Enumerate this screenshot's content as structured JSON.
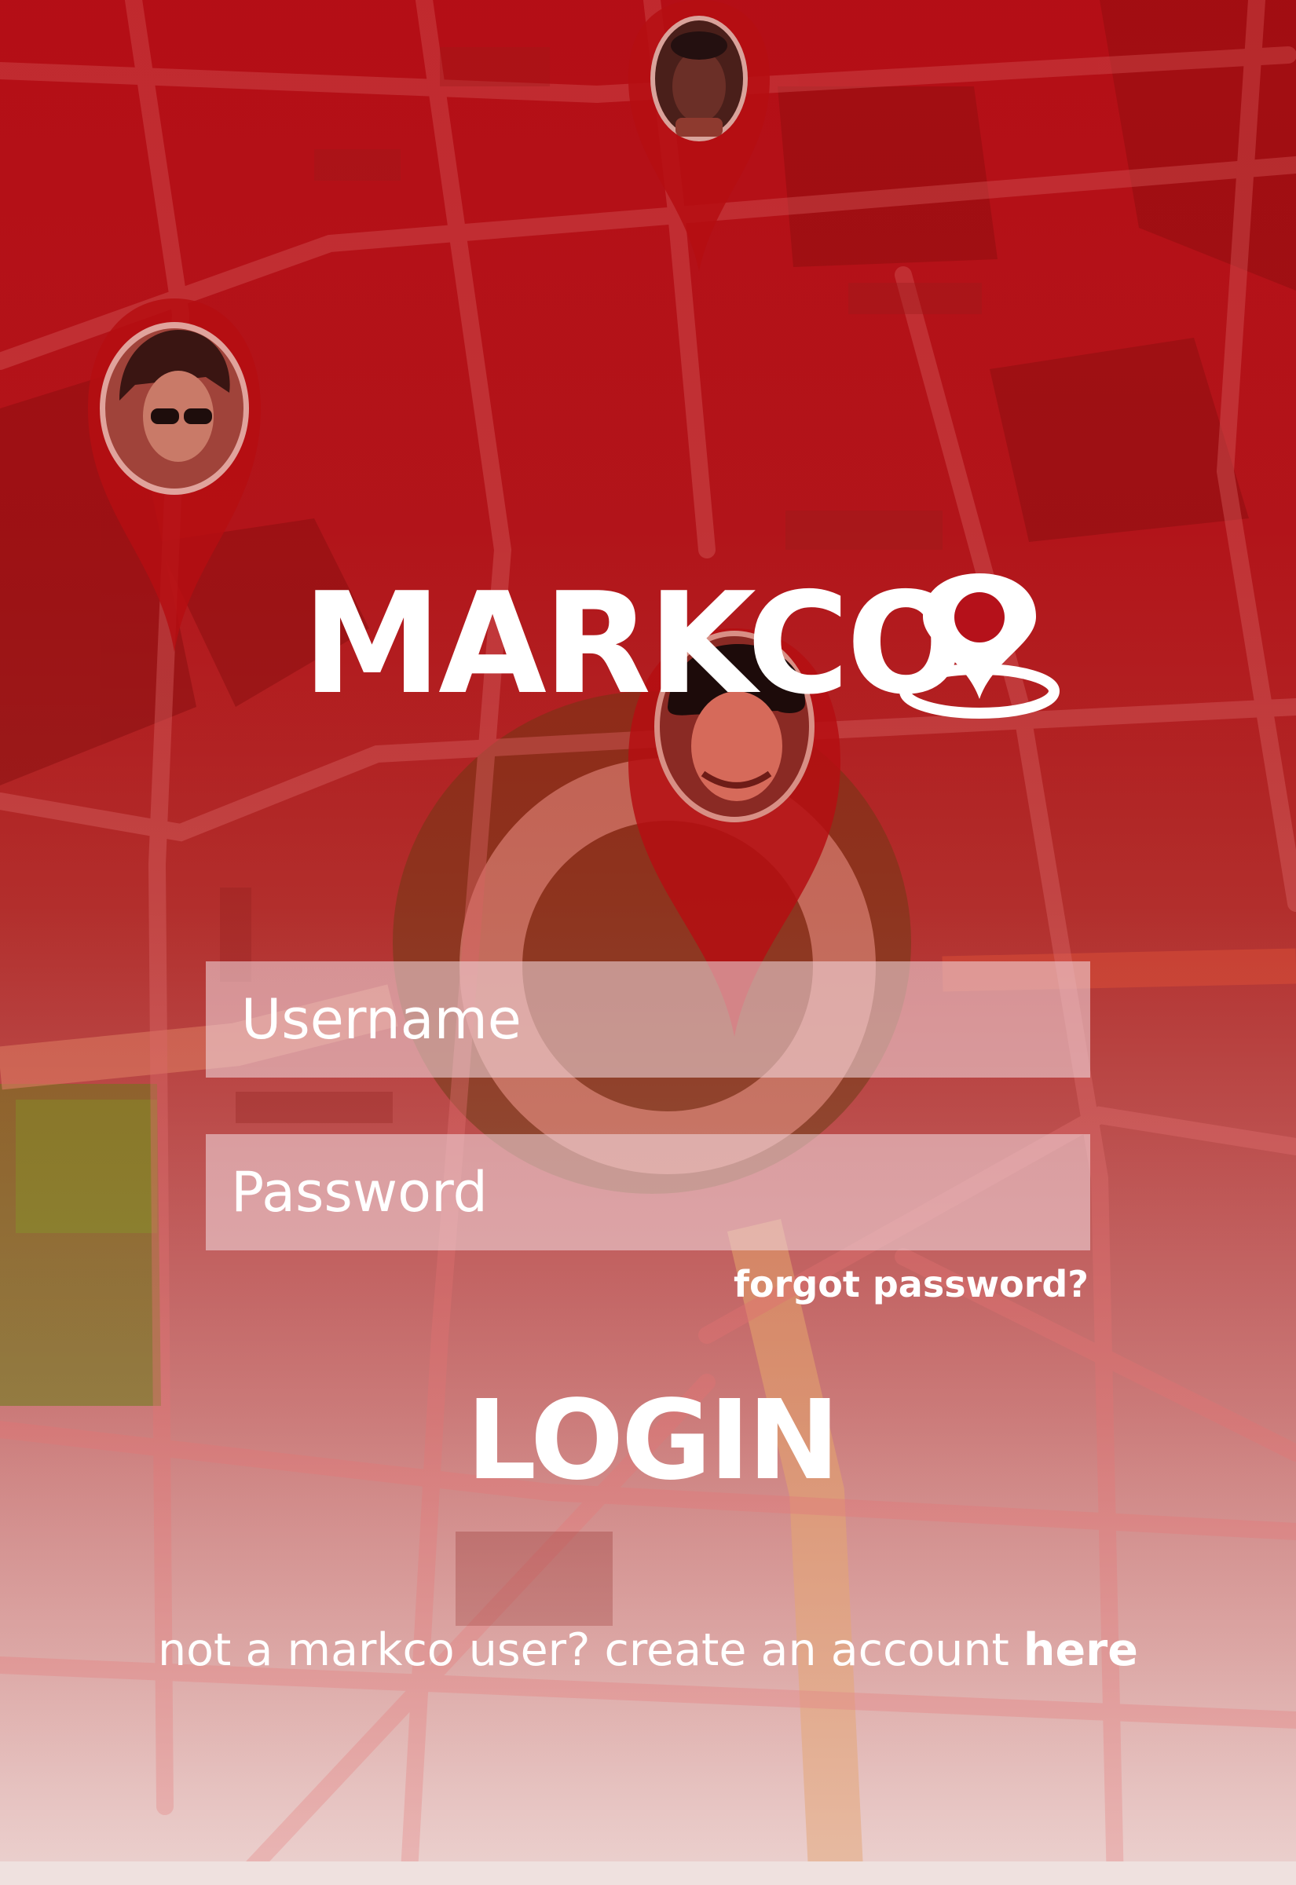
{
  "app": {
    "logo_text": "MARKCO",
    "brand_color": "#b5111a"
  },
  "login_form": {
    "username_placeholder": "Username",
    "password_placeholder": "Password",
    "forgot_label": "forgot password?",
    "login_label": "LOGIN"
  },
  "signup": {
    "prompt": "not a markco user? create an account ",
    "link_label": "here"
  },
  "icons": {
    "pins": [
      "location-pin-avatar-icon",
      "location-pin-avatar-icon",
      "location-pin-avatar-icon"
    ],
    "logo_pin": "location-pin-icon"
  }
}
